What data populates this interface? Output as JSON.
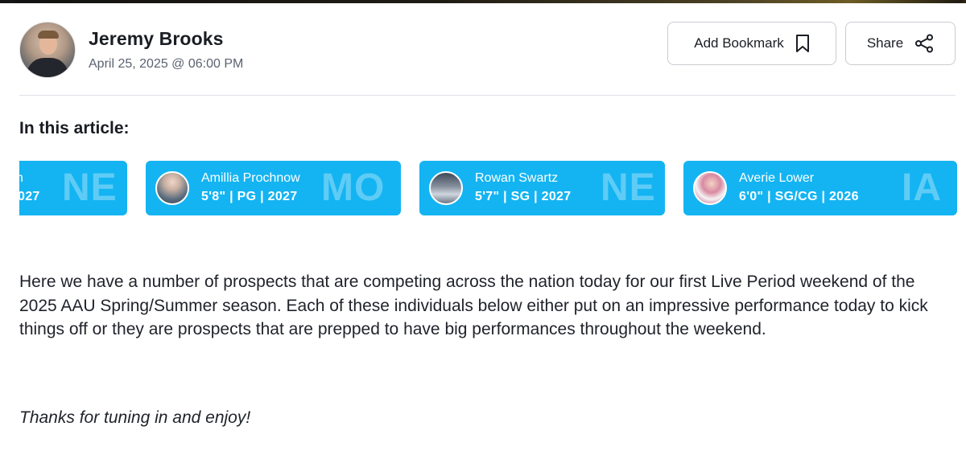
{
  "author": {
    "name": "Jeremy Brooks",
    "date": "April 25, 2025 @ 06:00 PM"
  },
  "actions": {
    "bookmark_label": "Add Bookmark",
    "share_label": "Share"
  },
  "article_nav": {
    "title": "In this article:",
    "cards": [
      {
        "name": "n",
        "meta": "027",
        "state": "NE"
      },
      {
        "name": "Amillia Prochnow",
        "meta": "5'8\" | PG | 2027",
        "state": "MO"
      },
      {
        "name": "Rowan Swartz",
        "meta": "5'7\" | SG | 2027",
        "state": "NE"
      },
      {
        "name": "Averie Lower",
        "meta": "6'0\" | SG/CG | 2026",
        "state": "IA"
      }
    ]
  },
  "content": {
    "paragraph": "Here we have a number of prospects that are competing across the nation today for our first Live Period weekend of the 2025 AAU Spring/Summer season. Each of these individuals below either put on an impressive performance today to kick things off or they are prospects that are prepped to have big performances throughout the weekend.",
    "closing": "Thanks for tuning in and enjoy!"
  },
  "colors": {
    "card_bg": "#14b4f2",
    "text": "#1a1d23",
    "muted": "#5b6270"
  }
}
